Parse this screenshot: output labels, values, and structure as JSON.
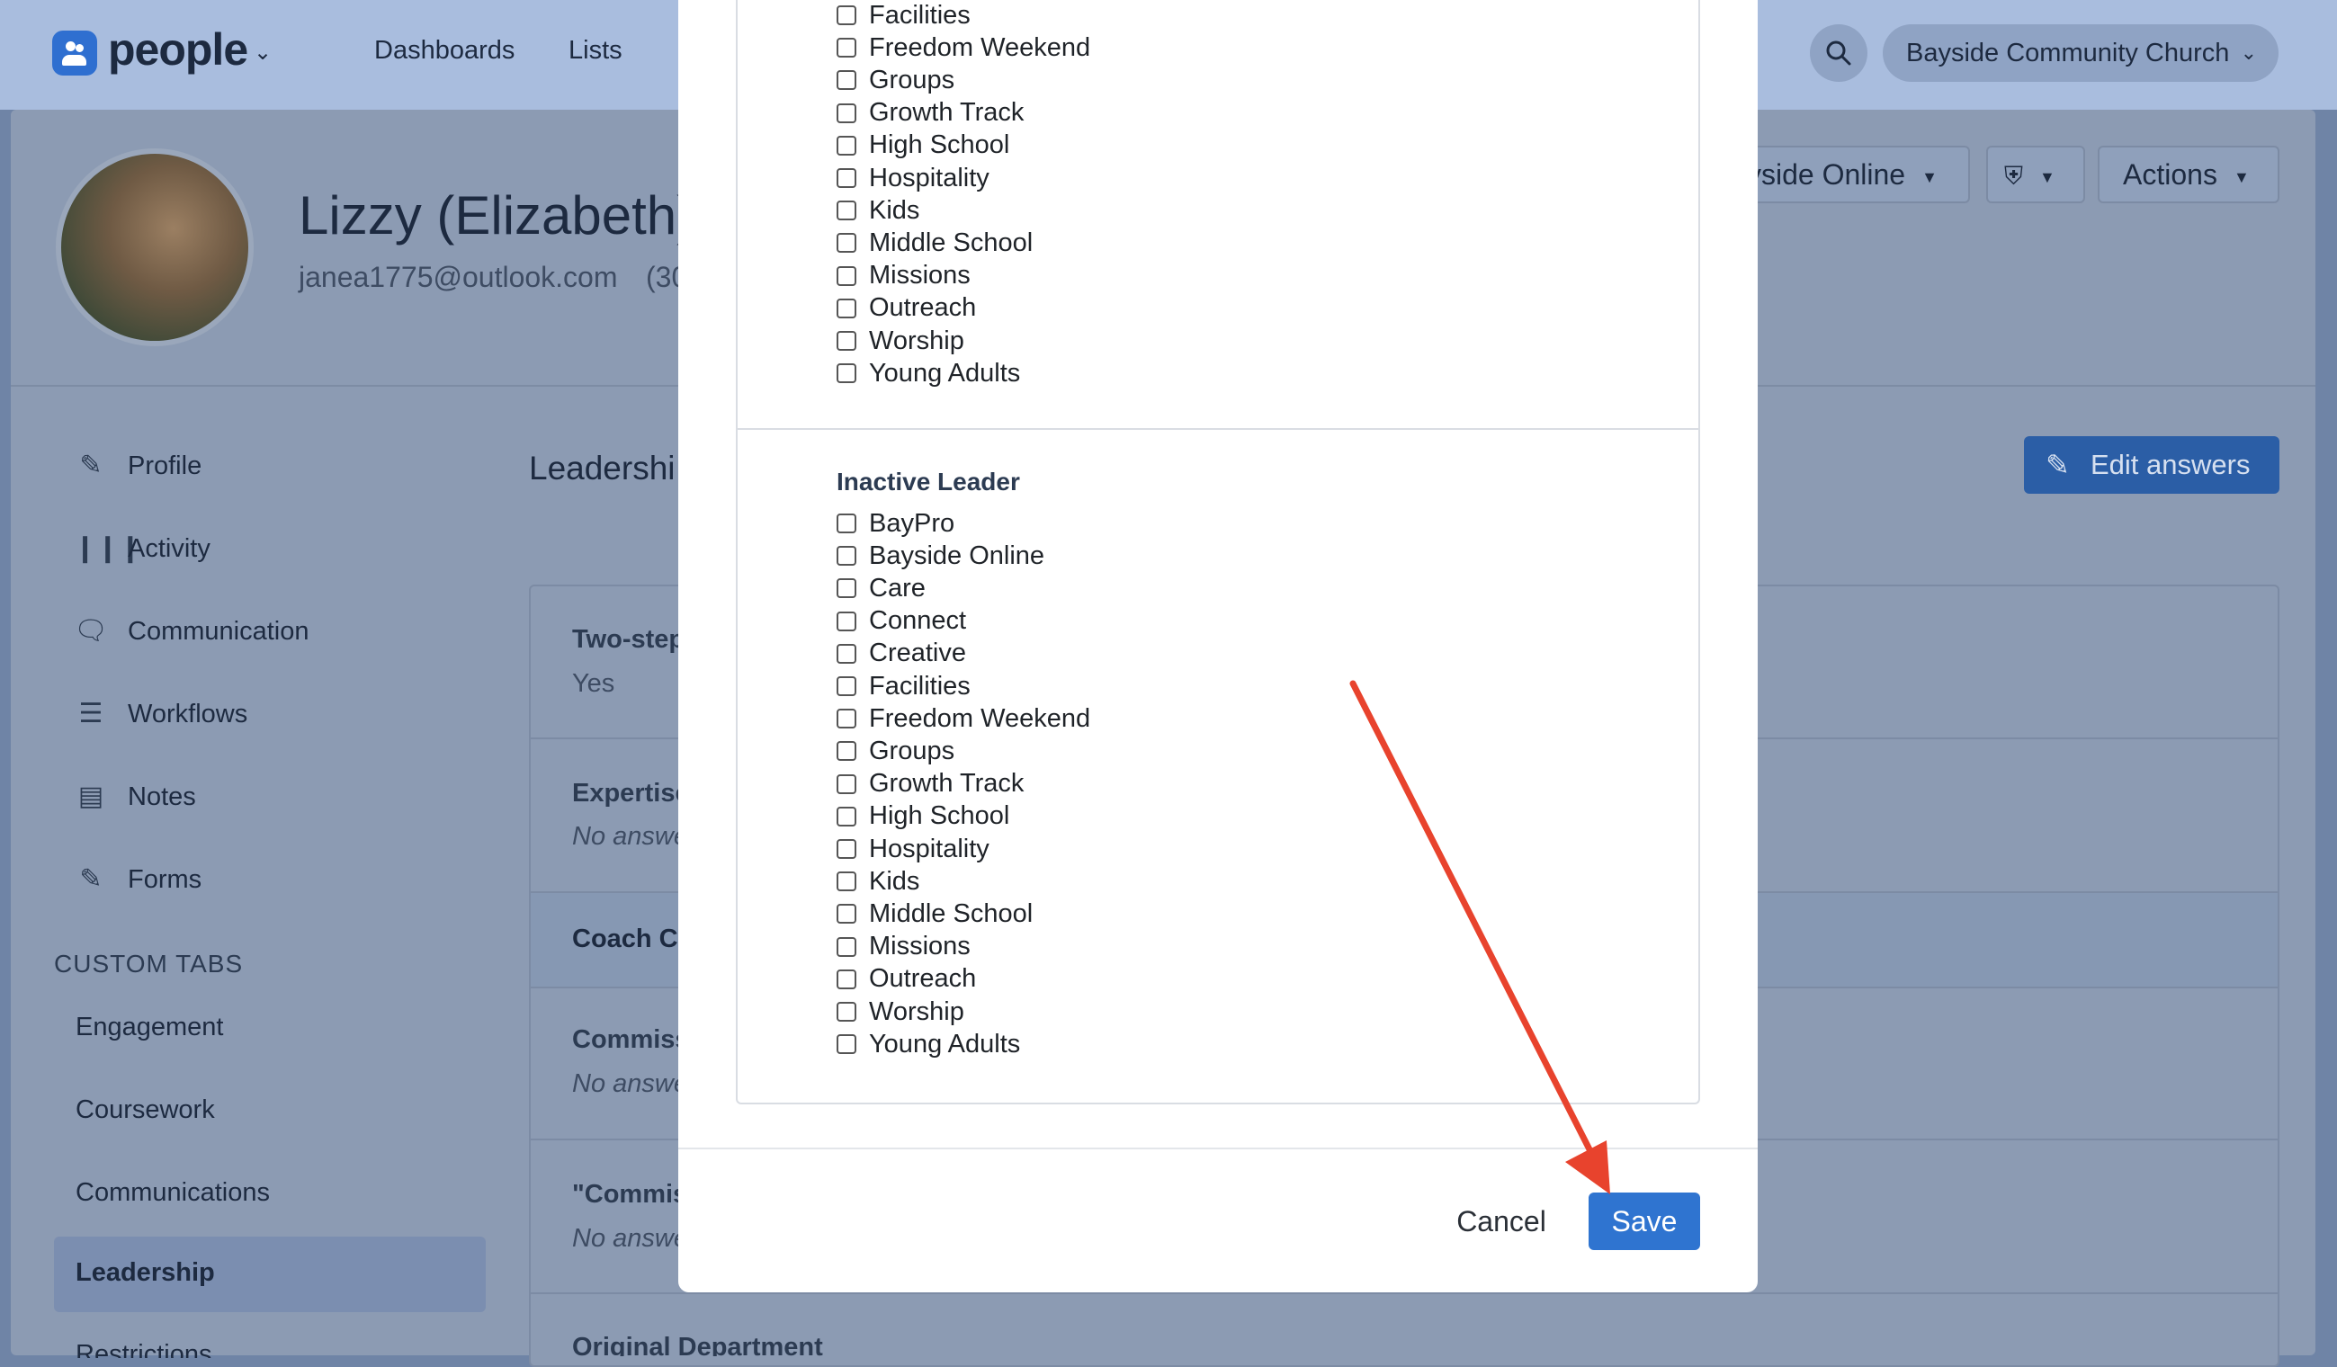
{
  "app": {
    "brand": "people",
    "nav": [
      "Dashboards",
      "Lists"
    ],
    "org_name": "Bayside Community Church"
  },
  "person": {
    "name": "Lizzy (Elizabeth) B",
    "email": "janea1775@outlook.com",
    "phone_fragment": "(30"
  },
  "header_buttons": {
    "campus": "yside Online",
    "actions": "Actions"
  },
  "sidebar": {
    "items": [
      {
        "label": "Profile",
        "icon": "pencil-icon"
      },
      {
        "label": "Activity",
        "icon": "activity-bars-icon"
      },
      {
        "label": "Communication",
        "icon": "chat-bubble-icon"
      },
      {
        "label": "Workflows",
        "icon": "checklist-icon"
      },
      {
        "label": "Notes",
        "icon": "note-icon"
      },
      {
        "label": "Forms",
        "icon": "form-edit-icon"
      }
    ],
    "custom_tabs_heading": "CUSTOM TABS",
    "custom_tabs": [
      "Engagement",
      "Coursework",
      "Communications"
    ],
    "active_tab": "Leadership",
    "cut_tab": "Restrictions"
  },
  "main": {
    "section_title": "Leadershi",
    "edit_answers": "Edit answers",
    "rows": [
      {
        "label": "Two-step",
        "value": "Yes"
      },
      {
        "label": "Expertise",
        "value": "No answe"
      },
      {
        "label": "Coach C",
        "value": ""
      },
      {
        "label": "Commiss",
        "value": "No answe"
      },
      {
        "label": "\"Commis",
        "value": "No answe"
      },
      {
        "label": "Original Department",
        "value": ""
      }
    ]
  },
  "modal": {
    "group1_options": [
      "Facilities",
      "Freedom Weekend",
      "Groups",
      "Growth Track",
      "High School",
      "Hospitality",
      "Kids",
      "Middle School",
      "Missions",
      "Outreach",
      "Worship",
      "Young Adults"
    ],
    "group2_title": "Inactive Leader",
    "group2_options": [
      "BayPro",
      "Bayside Online",
      "Care",
      "Connect",
      "Creative",
      "Facilities",
      "Freedom Weekend",
      "Groups",
      "Growth Track",
      "High School",
      "Hospitality",
      "Kids",
      "Middle School",
      "Missions",
      "Outreach",
      "Worship",
      "Young Adults"
    ],
    "cancel": "Cancel",
    "save": "Save"
  },
  "colors": {
    "accent": "#2f74d0",
    "annotation_arrow": "#e8432d"
  }
}
